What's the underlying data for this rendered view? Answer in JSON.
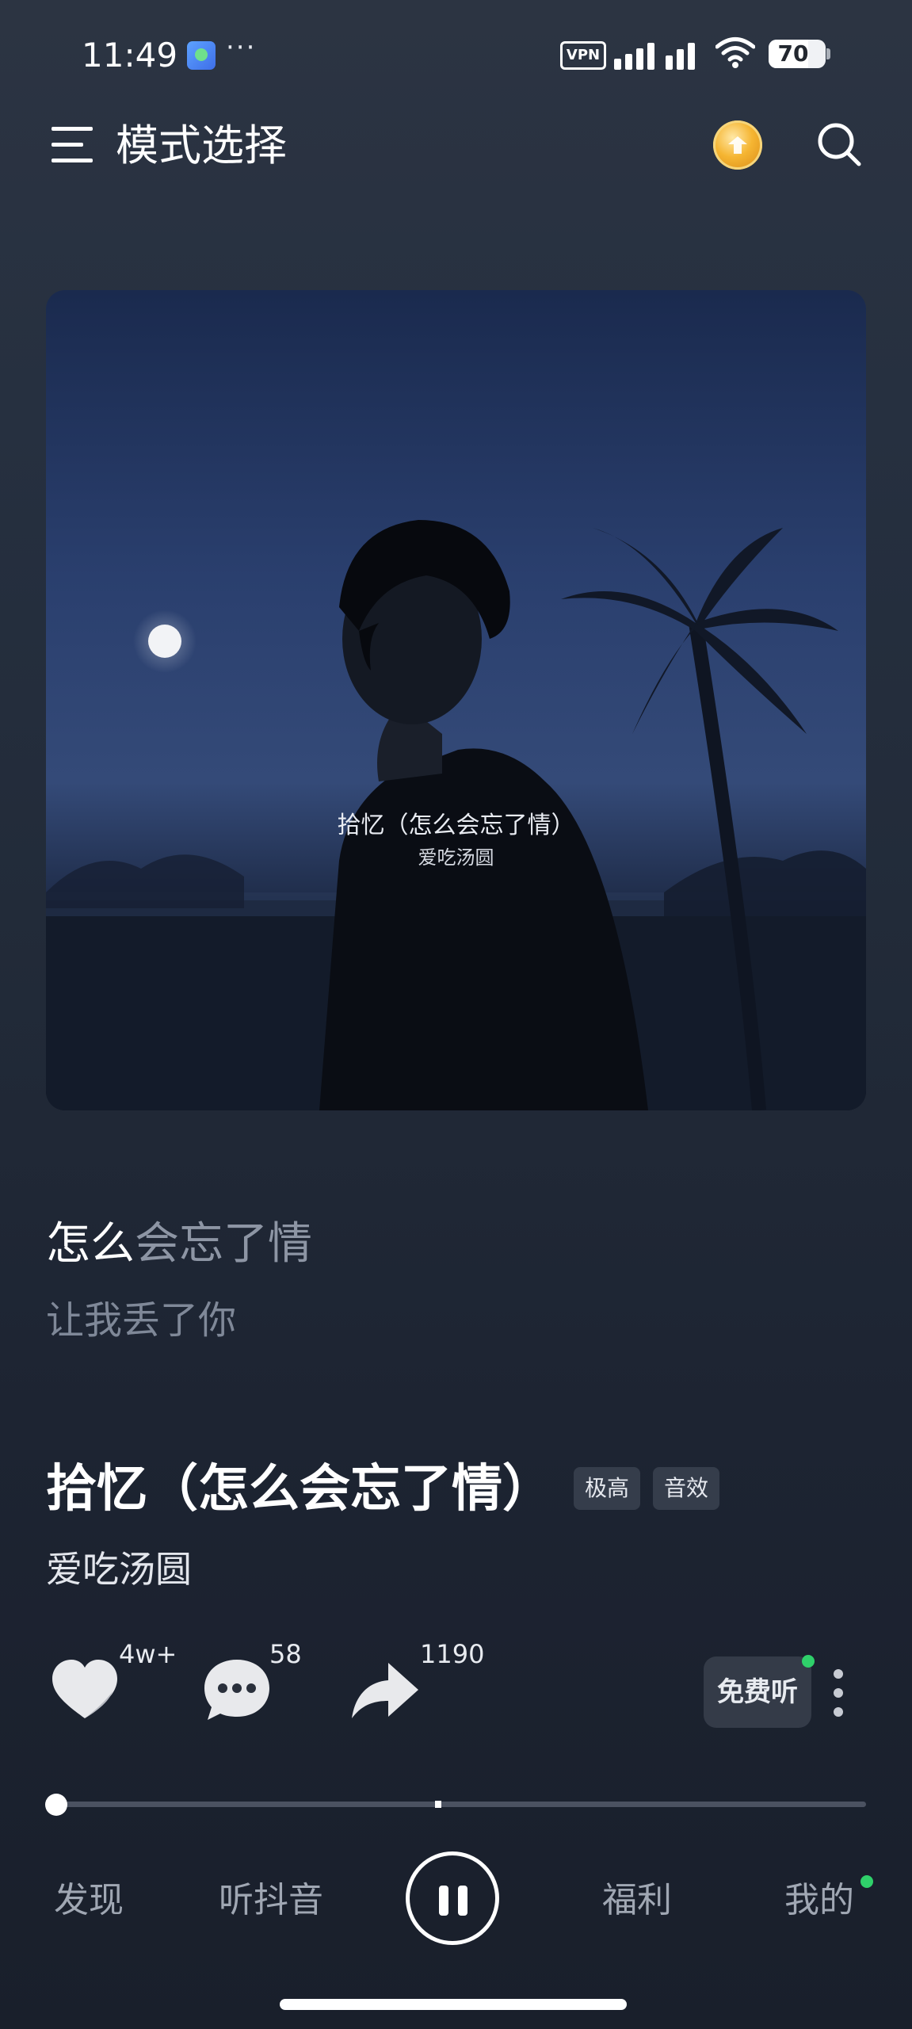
{
  "status_bar": {
    "time": "11:49",
    "notification_more": "···",
    "vpn": "VPN",
    "battery": "70"
  },
  "header": {
    "title": "模式选择"
  },
  "album": {
    "cover_title": "拾忆（怎么会忘了情）",
    "cover_artist": "爱吃汤圆"
  },
  "lyrics": {
    "current_sung": "怎么",
    "current_unsung": "会忘了情",
    "next": "让我丢了你"
  },
  "song": {
    "title": "拾忆（怎么会忘了情）",
    "tag_quality": "极高",
    "tag_effect": "音效",
    "artist": "爱吃汤圆"
  },
  "actions": {
    "like_count": "4w+",
    "comment_count": "58",
    "share_count": "1190",
    "free_listen": "免费听"
  },
  "nav": {
    "discover": "发现",
    "listen_douyin": "听抖音",
    "welfare": "福利",
    "mine": "我的"
  },
  "colors": {
    "accent_green": "#2fd06a",
    "coin_gold": "#f5b532"
  },
  "icons": {
    "menu": "menu-icon",
    "coin": "coin-icon",
    "search": "search-icon",
    "like": "heart-icon",
    "comment": "comment-icon",
    "share": "share-icon",
    "more": "more-icon",
    "pause": "pause-icon"
  }
}
